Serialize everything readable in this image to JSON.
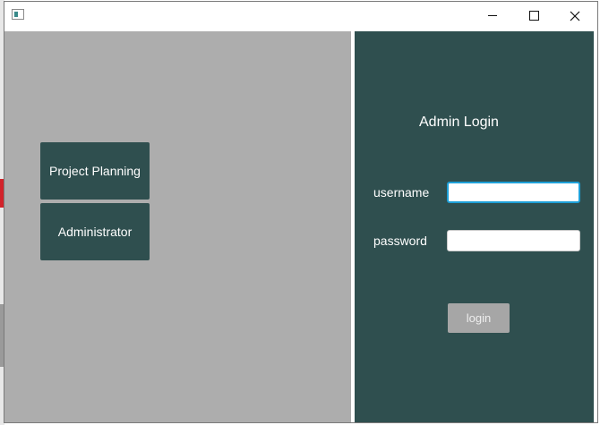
{
  "window": {
    "title": "",
    "controls": {
      "minimize_icon": "minimize-icon",
      "maximize_icon": "maximize-icon",
      "close_icon": "close-icon"
    }
  },
  "nav": {
    "items": [
      {
        "label": "Project Planning"
      },
      {
        "label": "Administrator"
      }
    ]
  },
  "login": {
    "title": "Admin Login",
    "username_label": "username",
    "username_value": "",
    "password_label": "password",
    "password_value": "",
    "button_label": "login"
  },
  "colors": {
    "panel_dark": "#2f4f4f",
    "panel_grey": "#adadad",
    "focus_border": "#1ea0d8",
    "login_button": "#a6a6a6"
  }
}
